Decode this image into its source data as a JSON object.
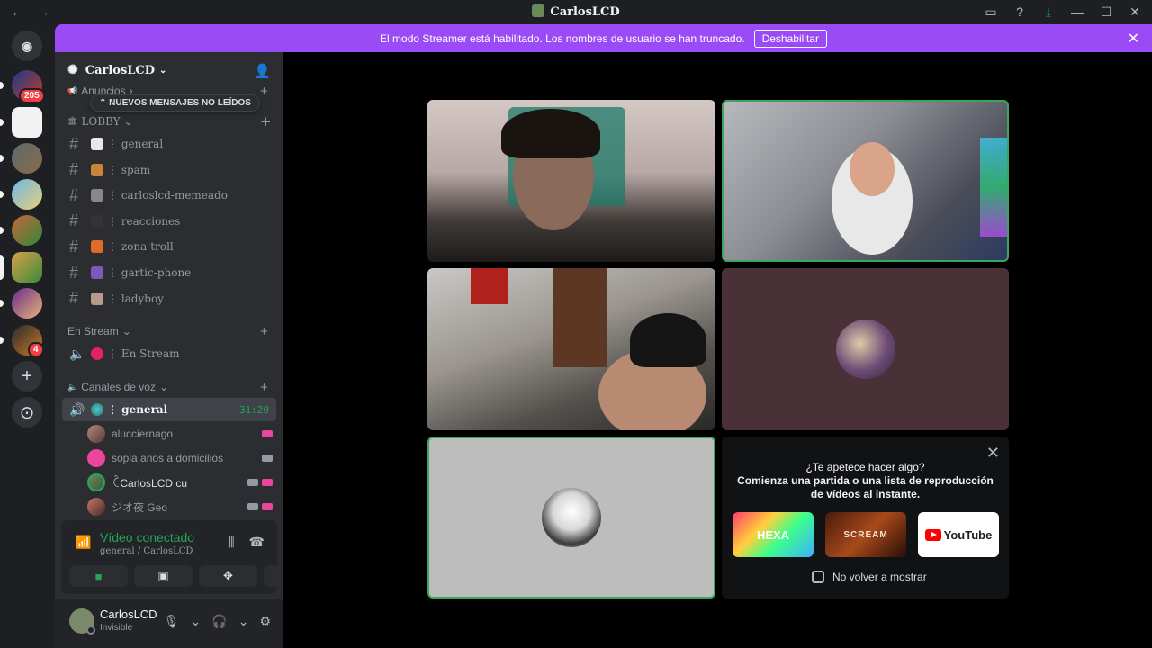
{
  "window": {
    "title": "CarlosLCD",
    "back": "←",
    "forward": "→"
  },
  "banner": {
    "text": "El modo Streamer está habilitado. Los nombres de usuario se han truncado.",
    "button": "Deshabilitar",
    "close": "✕",
    "color": "#9b4bf5"
  },
  "guilds": {
    "badges": {
      "first": "205",
      "last": "4"
    },
    "add": "+",
    "discover": "⊙"
  },
  "server": {
    "name": "CarlosLCD",
    "chev": "⌄"
  },
  "unread_pill": "⌃  NUEVOS MENSAJES NO LEÍDOS",
  "categories": {
    "anuncios": "Anuncios",
    "lobby": "LOBBY",
    "stream": "En Stream",
    "voz": "Canales de voz"
  },
  "channels": [
    {
      "name": "⋮ general",
      "emoji": "💬"
    },
    {
      "name": "⋮ spam",
      "emoji": "🧑"
    },
    {
      "name": "⋮ carloslcd-memeado",
      "emoji": "🐱"
    },
    {
      "name": "⋮ reacciones",
      "emoji": "🎧"
    },
    {
      "name": "⋮ zona-troll",
      "emoji": "🎃"
    },
    {
      "name": "⋮ gartic-phone",
      "emoji": "📱"
    },
    {
      "name": "⋮ ladyboy",
      "emoji": "👬"
    }
  ],
  "stream_channel": {
    "name": "⋮ En Stream"
  },
  "voice_channel": {
    "name": "⋮ general",
    "timer": "31:20"
  },
  "voice_users": [
    {
      "name": "alucciernago"
    },
    {
      "name": "sopla anos a domicilios"
    },
    {
      "name": "ꉓCarlosLCD cu"
    },
    {
      "name": "ジオ夜 Geo"
    }
  ],
  "voice_panel": {
    "status": "Vídeo conectado",
    "sub": "general / CarlosLCD"
  },
  "user": {
    "name": "CarlosLCD",
    "status": "Invisible"
  },
  "activity": {
    "close": "✕",
    "line1": "¿Te apetece hacer algo?",
    "line2": "Comienza una partida o una lista de reproducción",
    "line3": "de vídeos al instante.",
    "cards": [
      "HEXA",
      "SCREAM",
      "YouTube"
    ],
    "dont_show": "No volver a mostrar"
  },
  "colors": {
    "accent": "#23a55a",
    "speaking": "#3ba55d",
    "danger": "#f23f43"
  }
}
